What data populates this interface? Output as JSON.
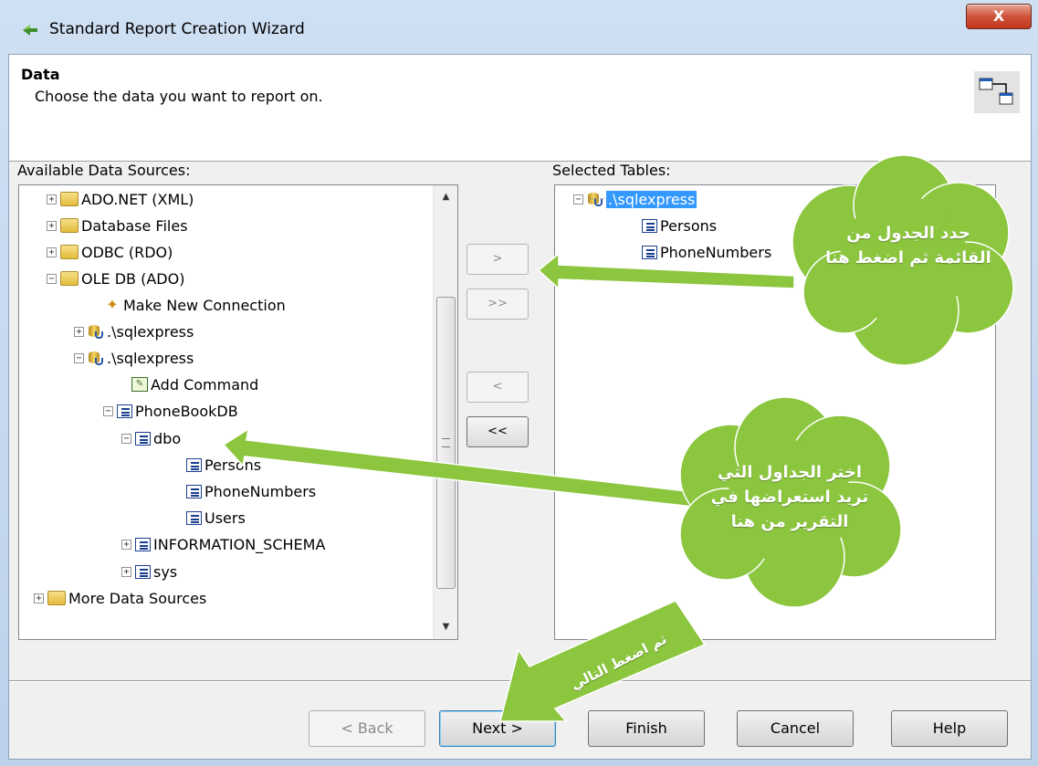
{
  "window": {
    "title": "Standard Report Creation Wizard",
    "close_glyph": "X"
  },
  "header": {
    "title": "Data",
    "subtitle": "Choose the data you want to report on."
  },
  "available": {
    "label": "Available Data Sources:",
    "tree": [
      {
        "text": "ADO.NET (XML)",
        "exp": "+",
        "icon": "folder-icon"
      },
      {
        "text": "Database Files",
        "exp": "+",
        "icon": "folder-icon"
      },
      {
        "text": "ODBC (RDO)",
        "exp": "+",
        "icon": "folder-icon"
      },
      {
        "text": "OLE DB (ADO)",
        "exp": "−",
        "icon": "folder-icon"
      },
      {
        "text": "Make New Connection",
        "icon": "wand-icon"
      },
      {
        "text": ".\\sqlexpress",
        "exp": "+",
        "icon": "database-icon"
      },
      {
        "text": ".\\sqlexpress",
        "exp": "−",
        "icon": "database-icon"
      },
      {
        "text": "Add Command",
        "icon": "command-icon"
      },
      {
        "text": "PhoneBookDB",
        "exp": "−",
        "icon": "table-icon"
      },
      {
        "text": "dbo",
        "exp": "−",
        "icon": "table-icon"
      },
      {
        "text": "Persons",
        "icon": "table-icon"
      },
      {
        "text": "PhoneNumbers",
        "icon": "table-icon"
      },
      {
        "text": "Users",
        "icon": "table-icon"
      },
      {
        "text": "INFORMATION_SCHEMA",
        "exp": "+",
        "icon": "table-icon"
      },
      {
        "text": "sys",
        "exp": "+",
        "icon": "table-icon"
      },
      {
        "text": "More Data Sources",
        "exp": "+",
        "icon": "folder-icon"
      }
    ]
  },
  "selected": {
    "label": "Selected Tables:",
    "tree": [
      {
        "text": ".\\sqlexpress",
        "exp": "−",
        "icon": "database-icon",
        "selected": true
      },
      {
        "text": "Persons",
        "icon": "table-icon"
      },
      {
        "text": "PhoneNumbers",
        "icon": "table-icon"
      }
    ]
  },
  "move_buttons": {
    "add": ">",
    "add_all": ">>",
    "remove": "<",
    "remove_all": "<<"
  },
  "footer": {
    "back": "< Back",
    "next": "Next >",
    "finish": "Finish",
    "cancel": "Cancel",
    "help": "Help"
  },
  "annotations": {
    "top": "حدد الجدول من القائمة ثم اضغط هنا",
    "middle": "اختر الجداول التي تريد استعراضها في التقرير من هنا",
    "bottom": "ثم اضغط التالي"
  },
  "colors": {
    "annotation_green": "#8cc63f",
    "selection_blue": "#3399ff"
  }
}
